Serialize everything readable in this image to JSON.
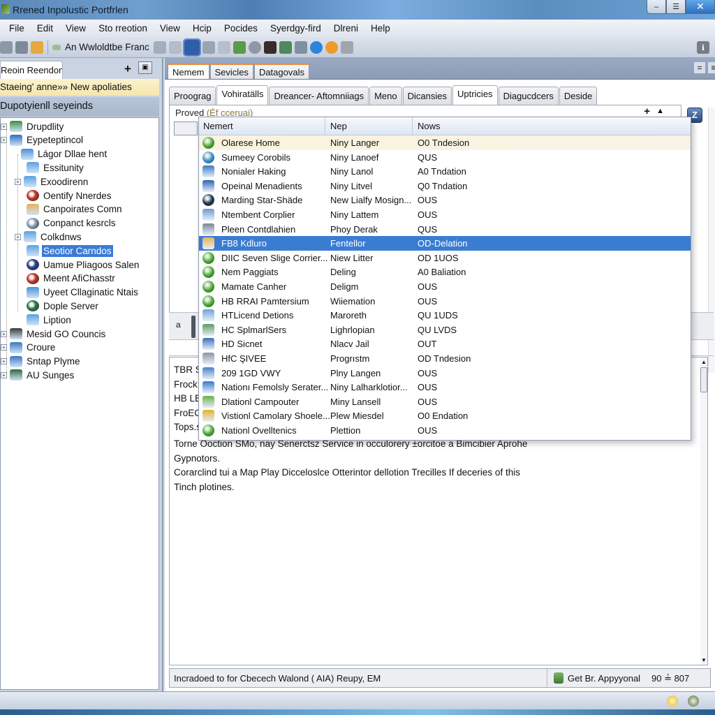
{
  "window": {
    "title": "Rrened Inpolustic Portfrlen",
    "controls": {
      "minimize": "–",
      "maximize": "☰",
      "close": "✕"
    }
  },
  "menubar": [
    "File",
    "Edit",
    "View",
    "Sto rreotion",
    "View",
    "Hcip",
    "Pocides",
    "Syerdgy-fird",
    "Dlreni",
    "Help"
  ],
  "toolbar": {
    "icons_left": [
      "settings-icon",
      "user-icon",
      "folder-icon"
    ],
    "label": "An Wwloldtbe Franc",
    "icons_right": [
      "list-icon",
      "card-icon",
      "save-icon",
      "document-icon",
      "wrench-icon",
      "tools-icon",
      "gauge-icon",
      "image-icon",
      "network-icon",
      "checkbox-icon",
      "browser-icon",
      "firefox-icon",
      "blank-icon"
    ],
    "right_button": "ℹ"
  },
  "left_pane": {
    "tab": "Reoin Reendon",
    "add": "+",
    "dock": "▣",
    "banner": "Staeing' anne»» New apoliaties",
    "header": "Dupotyienll seyeinds",
    "tree": [
      {
        "label": "Drupdlity",
        "level": 0,
        "expandable": true,
        "icon": "window-icon",
        "color": "#3e8d3e"
      },
      {
        "label": "Eypeteptincol",
        "level": 0,
        "expandable": true,
        "icon": "puzzle-icon",
        "color": "#2e6fc0"
      },
      {
        "label": "Lágor Dllae hent",
        "level": 1,
        "expandable": false,
        "icon": "network-folder-icon",
        "color": "#4a90d9"
      },
      {
        "label": "Essitunity",
        "level": 2,
        "expandable": false,
        "icon": "folder-icon",
        "color": "#5aa1e3"
      },
      {
        "label": "Exoodirenn",
        "level": 2,
        "expandable": true,
        "icon": "folder-icon",
        "color": "#5aa1e3"
      },
      {
        "label": "Oentify Nnerdes",
        "level": 2,
        "expandable": false,
        "icon": "colorful-ball-icon",
        "color": "#c83a2a"
      },
      {
        "label": "Canpoirates Comn",
        "level": 2,
        "expandable": false,
        "icon": "package-icon",
        "color": "#e2b25c"
      },
      {
        "label": "Conpanct kesrcls",
        "level": 2,
        "expandable": false,
        "icon": "disc-icon",
        "color": "#8fa3b5"
      },
      {
        "label": "Colkdnws",
        "level": 2,
        "expandable": true,
        "icon": "folder-icon",
        "color": "#5aa1e3"
      },
      {
        "label": "Seotior Carndos",
        "level": 2,
        "expandable": false,
        "icon": "briefcase-icon",
        "color": "#5aa1e3",
        "selected": true
      },
      {
        "label": "Uamue Pliagoos Salen",
        "level": 2,
        "expandable": false,
        "icon": "colorful-ball-icon",
        "color": "#2b3f8f"
      },
      {
        "label": "Meent AfiChasstr",
        "level": 2,
        "expandable": false,
        "icon": "colorful-ball-icon",
        "color": "#c83a2a"
      },
      {
        "label": "Uyeet Cllaginatic Ntais",
        "level": 2,
        "expandable": false,
        "icon": "network-folder-icon",
        "color": "#4a90d9"
      },
      {
        "label": "Dople Server",
        "level": 2,
        "expandable": false,
        "icon": "server-icon",
        "color": "#2e7d4f"
      },
      {
        "label": "Liption",
        "level": 2,
        "expandable": false,
        "icon": "folder-icon",
        "color": "#5aa1e3"
      },
      {
        "label": "Mesid GO Councis",
        "level": 0,
        "expandable": true,
        "icon": "monitor-icon",
        "color": "#3a3a3a"
      },
      {
        "label": "Croure",
        "level": 0,
        "expandable": true,
        "icon": "calendar-icon",
        "color": "#3c78c4"
      },
      {
        "label": "Sntap Plyme",
        "level": 0,
        "expandable": true,
        "icon": "stack-icon",
        "color": "#3c78c4"
      },
      {
        "label": "AU Sunges",
        "level": 0,
        "expandable": true,
        "icon": "chart-icon",
        "color": "#2d6b3a"
      }
    ]
  },
  "right_pane": {
    "doc_tabs": [
      {
        "label": "Nemem",
        "active": true
      },
      {
        "label": "Sevicles",
        "active": false
      },
      {
        "label": "Datagovals",
        "active": false
      }
    ],
    "top_buttons": [
      "=",
      "≡"
    ],
    "sub_tabs": [
      {
        "label": "Proograg",
        "active": false
      },
      {
        "label": "Vohiratälls",
        "active": true
      },
      {
        "label": "Dreancer- Aftomniiags",
        "active": false
      },
      {
        "label": "Meno",
        "active": false
      },
      {
        "label": "Dicansies",
        "active": false
      },
      {
        "label": "Uptricies",
        "active": true
      },
      {
        "label": "Diagucdcers",
        "active": false
      },
      {
        "label": "Deside",
        "active": false
      }
    ],
    "panel": {
      "label": "Proved",
      "label_muted": "(Éf cceruai)",
      "add": "+",
      "collapse": "▲",
      "side_button": "Z"
    },
    "mid_strip_label": "a",
    "text_line_prefixes": [
      "TBR S",
      "Frock",
      "HB LE",
      "FroEC",
      "Tops.s"
    ],
    "body_text": [
      "Torne Ooction SMo, nay Senerctsz Service in occulorery ±orcitoe a Bimcibier Aprohe Gypnotors.",
      "Corarclind tui a Map Play Dicceloslce Otterintor dellotion Trecilles If deceries of this",
      "Tinch plotines."
    ],
    "status": {
      "message": "Incradoed to for Cbecech Walond ( AIA) Reupy, EM",
      "approval": "Get Br. Appyyonal",
      "coords": "90 ≟ 807"
    }
  },
  "dropdown": {
    "columns": [
      "Nemert",
      "Nep",
      "Nows"
    ],
    "rows": [
      {
        "name": "Olarese Home",
        "nep": "Niny Langer",
        "nows": "O0 Tndesion",
        "icon": "globe-icon",
        "color": "#4caa3c",
        "shape": "round",
        "highlight": true
      },
      {
        "name": "Sumeey Corobils",
        "nep": "Niny Lanoef",
        "nows": "QUS",
        "icon": "bowl-icon",
        "color": "#3d8fd8",
        "shape": "round"
      },
      {
        "name": "Nonialer Haking",
        "nep": "Niny Lanol",
        "nows": "A0 Tndation",
        "icon": "building-icon",
        "color": "#3a7fc2",
        "shape": "square"
      },
      {
        "name": "Opeinal Menadients",
        "nep": "Niny Litvel",
        "nows": "Q0 Tndation",
        "icon": "grid-icon",
        "color": "#2d62b8",
        "shape": "square"
      },
      {
        "name": "Marding Star-Shäde",
        "nep": "New Lialfy Mosign...",
        "nows": "OUS",
        "icon": "dark-orb-icon",
        "color": "#1d2c55",
        "shape": "round"
      },
      {
        "name": "Ntembent Corplier",
        "nep": "Niny Lattem",
        "nows": "OUS",
        "icon": "document-folder-icon",
        "color": "#6e9cd0",
        "shape": "square"
      },
      {
        "name": "Pleen Contdlahien",
        "nep": "Phoy Derak",
        "nows": "QUS",
        "icon": "tool-icon",
        "color": "#7b8796",
        "shape": "square"
      },
      {
        "name": "FB8 Kdluro",
        "nep": "Fentellor",
        "nows": "OD-Delation",
        "icon": "package-icon",
        "color": "#e3b454",
        "shape": "square",
        "selected": true
      },
      {
        "name": "DIIC Seven Slige Corrier...",
        "nep": "Niew Litter",
        "nows": "OD 1UOS",
        "icon": "green-orb-icon",
        "color": "#4caa3c",
        "shape": "round"
      },
      {
        "name": "Nem Paggiats",
        "nep": "Deling",
        "nows": "A0 Baliation",
        "icon": "green-orb-icon",
        "color": "#4caa3c",
        "shape": "round"
      },
      {
        "name": "Mamate Canher",
        "nep": "Deligm",
        "nows": "OUS",
        "icon": "green-orb-icon",
        "color": "#4caa3c",
        "shape": "round"
      },
      {
        "name": "HB RRAI Pamtersium",
        "nep": "Wiiemation",
        "nows": "OUS",
        "icon": "green-orb-icon",
        "color": "#4caa3c",
        "shape": "round"
      },
      {
        "name": "HTLicend Detions",
        "nep": "Maroreth",
        "nows": "QU 1UDS",
        "icon": "arrow-folder-icon",
        "color": "#6ea4d8",
        "shape": "square"
      },
      {
        "name": "HC SplmarlSers",
        "nep": "Lighrlopian",
        "nows": "QU LVDS",
        "icon": "landscape-icon",
        "color": "#5b9b5e",
        "shape": "square"
      },
      {
        "name": "HD Sicnet",
        "nep": "Nlacv Jail",
        "nows": "OUT",
        "icon": "network-icon",
        "color": "#3d6fbf",
        "shape": "square"
      },
      {
        "name": "HfC ŞIVEE",
        "nep": "Progrıstm",
        "nows": "OD Tndesion",
        "icon": "envelope-icon",
        "color": "#8a96a6",
        "shape": "square"
      },
      {
        "name": "209 1GD VWY",
        "nep": "Plny Langen",
        "nows": "OUS",
        "icon": "tree-icon",
        "color": "#4a82c6",
        "shape": "square"
      },
      {
        "name": "Nationı Femolsly Serater...",
        "nep": "Niny Lalharklotior...",
        "nows": "OUS",
        "icon": "monitor-icon",
        "color": "#2f7cd0",
        "shape": "square"
      },
      {
        "name": "Dlationl Campouter",
        "nep": "Miny Lansell",
        "nows": "OUS",
        "icon": "chart-icon",
        "color": "#6ab04c",
        "shape": "square"
      },
      {
        "name": "Vistionl Camolary Shoele...",
        "nep": "Plew Miesdel",
        "nows": "O0 Endation",
        "icon": "chair-icon",
        "color": "#e5b12c",
        "shape": "square"
      },
      {
        "name": "Nationl Ovelltenics",
        "nep": "Plettion",
        "nows": "OUS",
        "icon": "leaf-orb-icon",
        "color": "#4caa3c",
        "shape": "round"
      }
    ]
  },
  "taskbar": {
    "tray": [
      "weather-icon",
      "clock-icon"
    ]
  }
}
